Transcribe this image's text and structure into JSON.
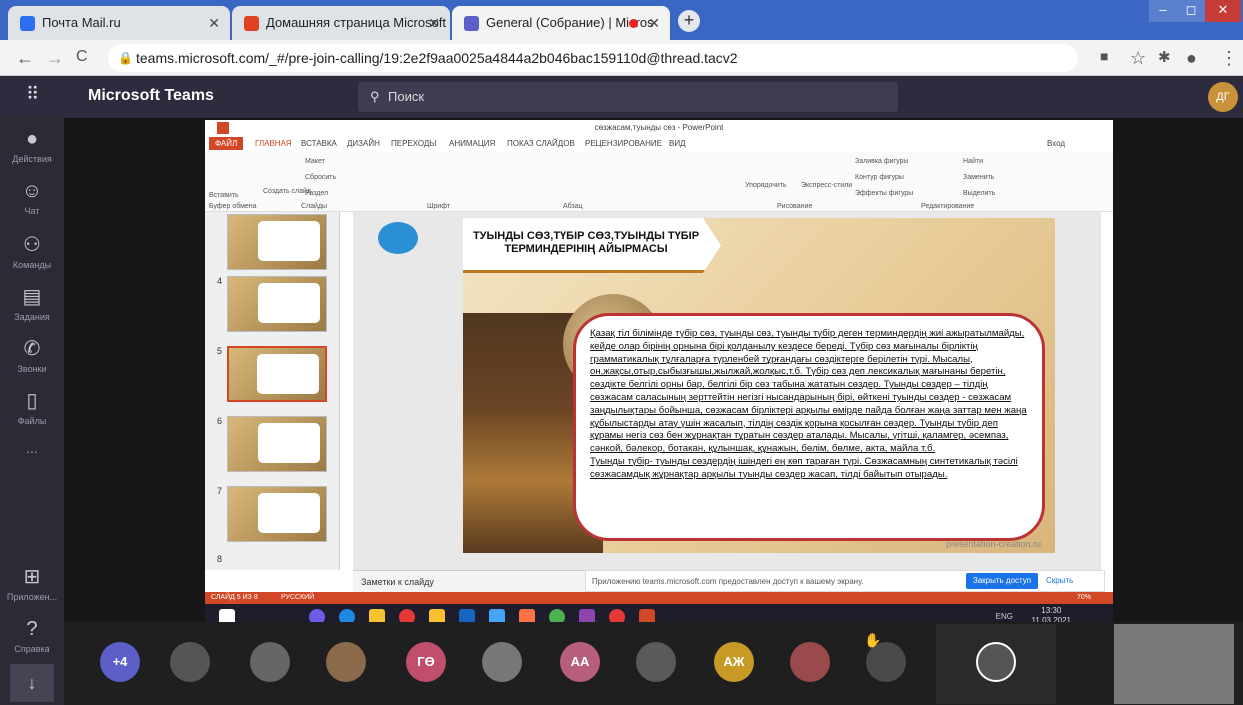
{
  "browser": {
    "tabs": [
      {
        "label": "Почта Mail.ru",
        "icon": "mail-icon",
        "color": "#2c6ef2"
      },
      {
        "label": "Домашняя страница Microsoft Offi",
        "icon": "office-icon",
        "color": "#e0431f"
      },
      {
        "label": "General (Собрание) | Micros",
        "icon": "teams-icon",
        "color": "#5b5fc7"
      }
    ],
    "url": "teams.microsoft.com/_#/pre-join-calling/19:2e2f9aa0025a4844a2b046bac159110d@thread.tacv2"
  },
  "teams": {
    "app_name": "Microsoft Teams",
    "search_placeholder": "Поиск",
    "avatar_initials": "ДГ",
    "rail": [
      {
        "label": "Действия",
        "icon": "bell-icon",
        "glyph": "🔔"
      },
      {
        "label": "Чат",
        "icon": "chat-icon",
        "glyph": "☺"
      },
      {
        "label": "Команды",
        "icon": "teams-group-icon",
        "glyph": "⚇"
      },
      {
        "label": "Задания",
        "icon": "assignments-icon",
        "glyph": "🗐"
      },
      {
        "label": "Звонки",
        "icon": "phone-icon",
        "glyph": "✆"
      },
      {
        "label": "Файлы",
        "icon": "file-icon",
        "glyph": "🗋"
      },
      {
        "label": "...",
        "icon": "more-icon",
        "glyph": ""
      },
      {
        "label": "Приложен...",
        "icon": "apps-icon",
        "glyph": "⊞"
      },
      {
        "label": "Справка",
        "icon": "help-icon",
        "glyph": "?"
      }
    ]
  },
  "powerpoint": {
    "window_title": "сөзжасам,туынды сөз - PowerPoint",
    "signin": "Вход",
    "tabs": [
      "ФАЙЛ",
      "ГЛАВНАЯ",
      "ВСТАВКА",
      "ДИЗАЙН",
      "ПЕРЕХОДЫ",
      "АНИМАЦИЯ",
      "ПОКАЗ СЛАЙДОВ",
      "РЕЦЕНЗИРОВАНИЕ",
      "ВИД"
    ],
    "ribbon": {
      "paste": "Вставить",
      "create_slide": "Создать слайд",
      "layout": "Макет",
      "reset": "Сбросить",
      "section": "Раздел",
      "arrange": "Упорядочить",
      "quick_styles": "Экспресс-стили",
      "fill": "Заливка фигуры",
      "outline": "Контур фигуры",
      "effects": "Эффекты фигуры",
      "find": "Найти",
      "replace": "Заменить",
      "select": "Выделить",
      "groups": [
        "Буфер обмена",
        "Слайды",
        "Шрифт",
        "Абзац",
        "Рисование",
        "Редактирование"
      ]
    },
    "thumbnails": [
      "4",
      "5",
      "6",
      "7",
      "8"
    ],
    "selected_slide": "5",
    "slide": {
      "title": "ТУЫНДЫ СӨЗ,ТҮБІР СӨЗ,ТУЫНДЫ ТҮБІР ТЕРМИНДЕРІНІҢ АЙЫРМАСЫ",
      "body": "Қазақ тіл білімінде түбір сөз, туынды сөз, туынды түбір деген терминдердің жиі ажыратылмайды, кейде олар бірінің орнына бірі қолданылу кездесе береді. Түбір сөз мағыналы бірліктің грамматикалық тұлғаларға түрленбей тұрғандағы сөздіктерге берілетін түрі. Мысалы, он,жақсы,отыр,сыбызғышы,жылжай,жолқыс,т.б. Түбір сөз деп лексикалық мағынаны беретін, сөздікте белгілі орны бар, белгілі бір сөз табына жататын сөздер. Туынды сөздер – тілдің сөзжасам саласының зерттейтін негізгі нысандарының бірі, өйткені туынды сөздер - сөзжасам заңдылықтары бойынша, сөзжасам бірліктері арқылы өмірде пайда болған жаңа заттар мен жаңа құбылыстарды атау үшін жасалып, тілдің сөздік қорына қосылған сөздер. Туынды түбір деп құрамы негіз сөз бен жұрнақтан тұратын сөздер аталады. Мысалы, үгітші, қаламгер, әсемпаз, сәнкой, бәлекор, ботакан, құлыншақ, құнажын, бөлім, бөлме, акта, майла т.б.\nТуынды түбір- туынды сөздердің ішіндегі ең көп тараған түрі. Сөзжасамның синтетикалық тәсілі сөзжасамдық жұрнақтар арқылы туынды сөздер жасап, тілді байытып отырады.",
      "watermark": "presentation-creation.ru"
    },
    "notes_label": "Заметки к слайду",
    "status_left": "СЛАЙД 5 ИЗ 8",
    "status_lang": "РУССКИЙ",
    "zoom": "70%"
  },
  "share_bar": {
    "message": "Приложению teams.microsoft.com предоставлен доступ к вашему экрану.",
    "stop_button": "Закрыть доступ",
    "hide": "Скрыть"
  },
  "taskbar": {
    "lang": "ENG",
    "time": "13:30",
    "date": "11.03.2021"
  },
  "participants": [
    {
      "label": "+4",
      "color": "#5b5fc7"
    },
    {
      "label": "",
      "color": "#555"
    },
    {
      "label": "",
      "color": "#666"
    },
    {
      "label": "",
      "color": "#8a6a4a"
    },
    {
      "label": "ГӨ",
      "color": "#c04f6b"
    },
    {
      "label": "",
      "color": "#777"
    },
    {
      "label": "АА",
      "color": "#b75f7a"
    },
    {
      "label": "",
      "color": "#5a5a5a"
    },
    {
      "label": "АЖ",
      "color": "#c69a24"
    },
    {
      "label": "",
      "color": "#9a4a4a"
    },
    {
      "label": "",
      "color": "#4a4a4a"
    }
  ]
}
